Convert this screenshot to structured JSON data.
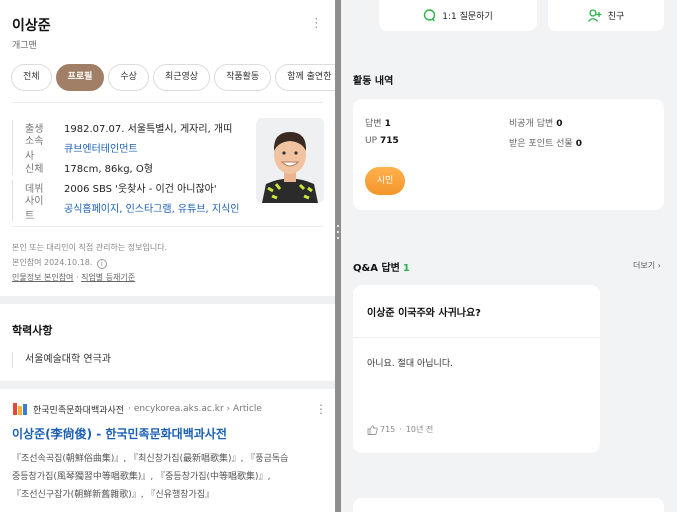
{
  "profile": {
    "name": "이상준",
    "job": "개그맨",
    "tabs": [
      {
        "label": "전체",
        "active": false
      },
      {
        "label": "프로필",
        "active": true
      },
      {
        "label": "수상",
        "active": false
      },
      {
        "label": "최근영상",
        "active": false
      },
      {
        "label": "작품활동",
        "active": false
      },
      {
        "label": "함께 출연한 다",
        "active": false
      }
    ],
    "info": {
      "birth_label": "출생",
      "birth_value": "1982.07.07. 서울특별시, 게자리, 개띠",
      "agency_label": "소속사",
      "agency_value": "큐브엔터테인먼트",
      "body_label": "신체",
      "body_value": "178cm, 86kg, O형",
      "debut_label": "데뷔",
      "debut_value": "2006 SBS '웃찾사 - 이건 아니잖아'",
      "site_label": "사이트",
      "sites": [
        "공식홈페이지",
        "인스타그램",
        "유튜브",
        "지식인"
      ]
    },
    "notice_line1": "본인 또는 대리인이 직접 관리하는 정보입니다.",
    "notice_line2": "본인참여 2024.10.18.",
    "notice_link1": "인물정보 본인참여",
    "notice_sep": "·",
    "notice_link2": "직업별 등재기준"
  },
  "education": {
    "title": "학력사항",
    "item": "서울예술대학 연극과"
  },
  "source": {
    "logo_text": "nE",
    "site_name": "한국민족문화대백과사전",
    "site_url": "· encykorea.aks.ac.kr › Article",
    "title": "이상준(李尙俊) - 한국민족문화대백과사전",
    "desc_lines": [
      "『조선속곡집(朝鮮俗曲集)』, 『최신창가집(最新唱歌集)』, 『풍금독습",
      "중등창가집(風琴獨習中等唱歌集)』, 『중등창가집(中等唱歌集)』,",
      "『조선신구잡가(朝鮮新舊雜歌)』, 『신유행창가집』"
    ]
  },
  "right": {
    "ask_button": "1:1 질문하기",
    "friend_button": "친구",
    "activity_title": "활동 내역",
    "answers_label": "답변",
    "answers_value": "1",
    "private_label": "비공개 답변",
    "private_value": "0",
    "up_label": "UP",
    "up_value": "715",
    "points_label": "받은 포인트 선물",
    "points_value": "0",
    "badge_label": "시민",
    "qa_title": "Q&A 답변",
    "qa_count": "1",
    "more_label": "더보기 ›",
    "question": "이상준 이국주와 사귀나요?",
    "answer": "아니요. 절대 아닙니다.",
    "likes": "715",
    "meta_sep": "·",
    "time_ago": "10년 전"
  },
  "colors": {
    "active_tab": "#a07f66",
    "link": "#1a5fb4",
    "badge": "#f39629",
    "green_accent": "#2fb14a"
  },
  "icons": [
    "kebab-icon",
    "info-icon",
    "chat-icon",
    "add-friend-icon",
    "thumbs-up-icon",
    "source-logo-icon"
  ]
}
